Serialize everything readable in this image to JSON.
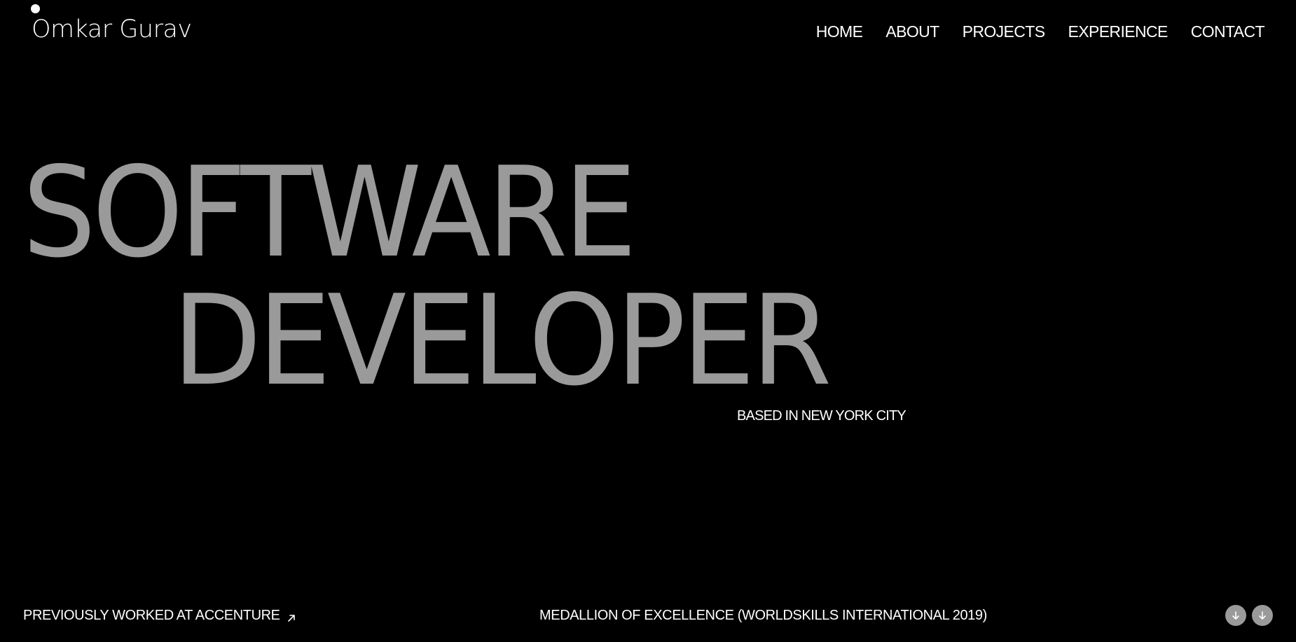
{
  "header": {
    "brand": "Omkar Gurav",
    "nav": [
      {
        "label": "HOME"
      },
      {
        "label": "ABOUT"
      },
      {
        "label": "PROJECTS"
      },
      {
        "label": "EXPERIENCE"
      },
      {
        "label": "CONTACT"
      }
    ]
  },
  "hero": {
    "line1": "SOFTWARE",
    "line2": "DEVELOPER",
    "location": "BASED IN NEW YORK CITY"
  },
  "footer": {
    "previous_work": "PREVIOUSLY WORKED AT ACCENTURE",
    "previous_work_icon": "arrow-up-right-icon",
    "award": "MEDALLION OF EXCELLENCE (WORLDSKILLS INTERNATIONAL 2019)",
    "scroll_icons": [
      "arrow-down-icon",
      "arrow-down-icon"
    ]
  },
  "colors": {
    "background": "#000000",
    "text": "#ffffff",
    "hero_text": "#9a9a9a",
    "button_fill": "#9a9a9a"
  }
}
